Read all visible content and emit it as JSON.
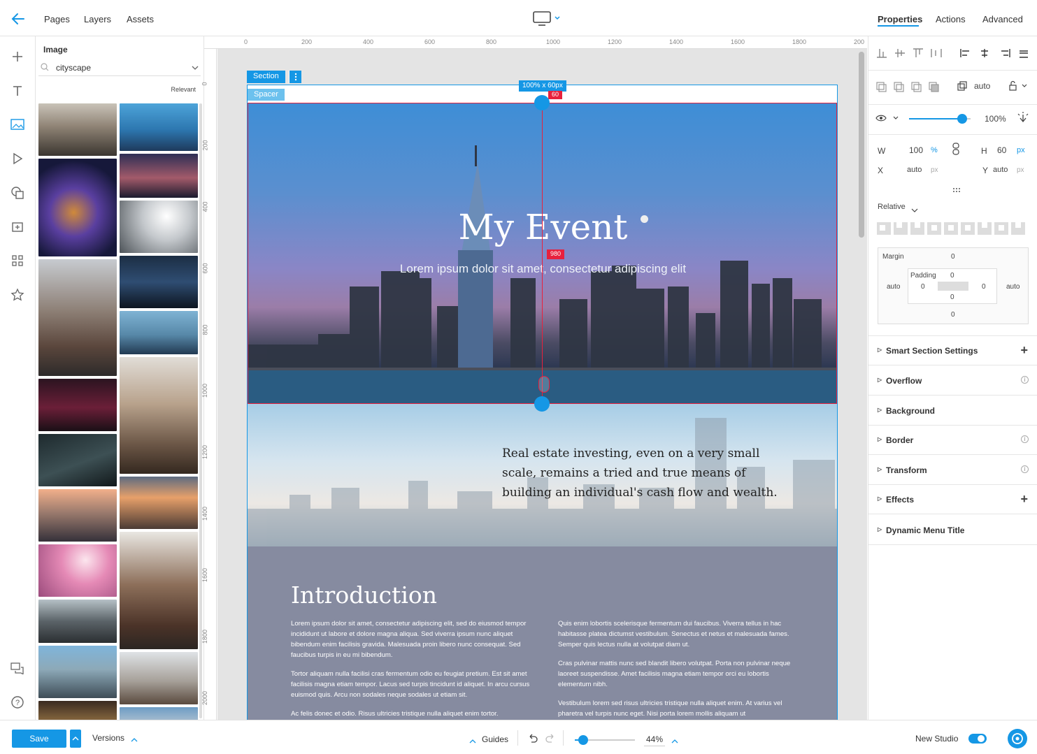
{
  "topbar": {
    "back_icon": "arrow-left-icon",
    "tabs": [
      "Pages",
      "Layers",
      "Assets"
    ],
    "device_icon": "desktop-icon",
    "right_tabs": [
      "Properties",
      "Actions",
      "Advanced"
    ],
    "active_right_tab": "Properties"
  },
  "leftbar": {
    "icons": [
      "plus-icon",
      "text-icon",
      "image-icon",
      "play-icon",
      "shapes-icon",
      "add-section-icon",
      "widgets-icon",
      "star-icon"
    ],
    "bottom_icons": [
      "chat-icon",
      "help-icon"
    ]
  },
  "assets": {
    "title": "Image",
    "search_value": "cityscape",
    "sort_label": "Relevant"
  },
  "ruler": {
    "top": [
      "0",
      "200",
      "400",
      "600",
      "800",
      "1000",
      "1200",
      "1400",
      "1600",
      "1800",
      "200"
    ],
    "left": [
      "0",
      "200",
      "400",
      "600",
      "800",
      "1000",
      "1200",
      "1400",
      "1600",
      "1800",
      "2000"
    ]
  },
  "canvas": {
    "section_label": "Section",
    "spacer_label": "Spacer",
    "size_badge": "100% x 60px",
    "height_badge": "60",
    "width_badge": "980",
    "hero_title": "My Event",
    "hero_subtitle": "Lorem ipsum dolor sit amet, consectetur adipiscing elit",
    "quote": "Real estate investing, even on a very small scale, remains a tried and true means of building an individual's cash flow and wealth.",
    "intro_title": "Introduction",
    "col1": [
      "Lorem ipsum dolor sit amet, consectetur adipiscing elit, sed do eiusmod tempor incididunt ut labore et dolore magna aliqua. Sed viverra ipsum nunc aliquet bibendum enim facilisis gravida. Malesuada proin libero nunc consequat. Sed faucibus turpis in eu mi bibendum.",
      "Tortor aliquam nulla facilisi cras fermentum odio eu feugiat pretium. Est sit amet facilisis magna etiam tempor. Lacus sed turpis tincidunt id aliquet. In arcu cursus euismod quis. Arcu non sodales neque sodales ut etiam sit.",
      "Ac felis donec et odio. Risus ultricies tristique nulla aliquet enim tortor."
    ],
    "col2": [
      "Quis enim lobortis scelerisque fermentum dui faucibus. Viverra tellus in hac habitasse platea dictumst vestibulum. Senectus et netus et malesuada fames. Semper quis lectus nulla at volutpat diam ut.",
      "Cras pulvinar mattis nunc sed blandit libero volutpat. Porta non pulvinar neque laoreet suspendisse. Amet facilisis magna etiam tempor orci eu lobortis elementum nibh.",
      "Vestibulum lorem sed risus ultricies tristique nulla aliquet enim. At varius vel pharetra vel turpis nunc eget. Nisi porta lorem mollis aliquam ut"
    ]
  },
  "properties": {
    "size_mode": "auto",
    "opacity_value": 0.86,
    "opacity_label": "100%",
    "w_label": "W",
    "w_value": "100",
    "w_unit": "%",
    "h_label": "H",
    "h_value": "60",
    "h_unit": "px",
    "x_label": "X",
    "x_value": "auto",
    "x_unit": "px",
    "y_label": "Y",
    "y_value": "auto",
    "y_unit": "px",
    "position": "Relative",
    "margin_label": "Margin",
    "margin_top": "0",
    "margin_left": "auto",
    "margin_right": "auto",
    "margin_bottom": "0",
    "padding_label": "Padding",
    "padding_top": "0",
    "padding_left": "0",
    "padding_right": "0",
    "padding_bottom": "0",
    "sections": [
      "Smart Section Settings",
      "Overflow",
      "Background",
      "Border",
      "Transform",
      "Effects",
      "Dynamic Menu Title"
    ]
  },
  "bottombar": {
    "save_label": "Save",
    "versions_label": "Versions",
    "guides_label": "Guides",
    "zoom_value": 0.14,
    "zoom_label": "44%",
    "new_studio_label": "New Studio",
    "new_studio_on": true
  },
  "colors": {
    "accent": "#1597e5",
    "guide_red": "#e8213d",
    "intro_bg": "#868ba0"
  }
}
